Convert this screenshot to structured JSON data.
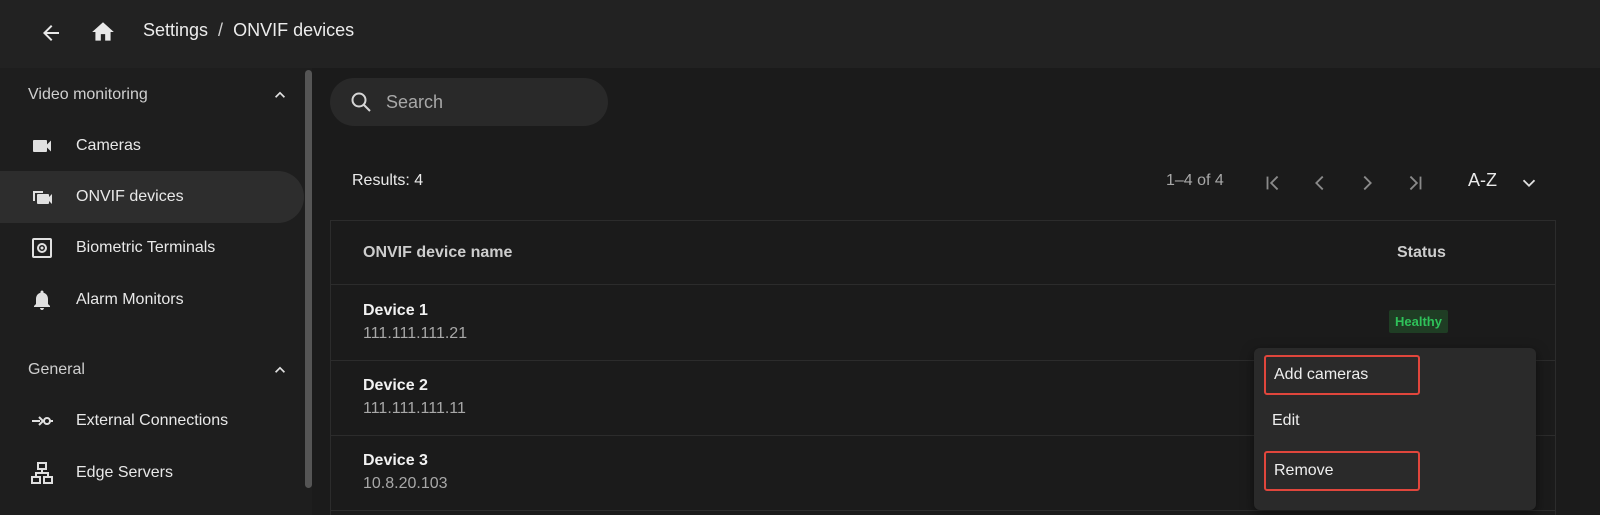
{
  "header": {
    "breadcrumb_root": "Settings",
    "breadcrumb_sep": "/",
    "breadcrumb_current": "ONVIF devices"
  },
  "sidebar": {
    "sections": [
      {
        "title": "Video monitoring",
        "items": [
          "Cameras",
          "ONVIF devices",
          "Biometric Terminals",
          "Alarm Monitors"
        ]
      },
      {
        "title": "General",
        "items": [
          "External Connections",
          "Edge Servers"
        ]
      }
    ],
    "active_item": "ONVIF devices"
  },
  "search": {
    "placeholder": "Search"
  },
  "list": {
    "results_label": "Results: 4",
    "range_label": "1–4 of 4",
    "sort_label": "A-Z",
    "columns": {
      "name": "ONVIF device name",
      "status": "Status"
    },
    "rows": [
      {
        "name": "Device 1",
        "ip": "111.111.111.21",
        "status": "Healthy"
      },
      {
        "name": "Device 2",
        "ip": "111.111.111.11",
        "status": ""
      },
      {
        "name": "Device 3",
        "ip": "10.8.20.103",
        "status": ""
      }
    ]
  },
  "context_menu": {
    "items": [
      "Add cameras",
      "Edit",
      "Remove"
    ]
  },
  "colors": {
    "accent_healthy": "#2fc25a",
    "highlight_border": "#e0463c"
  }
}
